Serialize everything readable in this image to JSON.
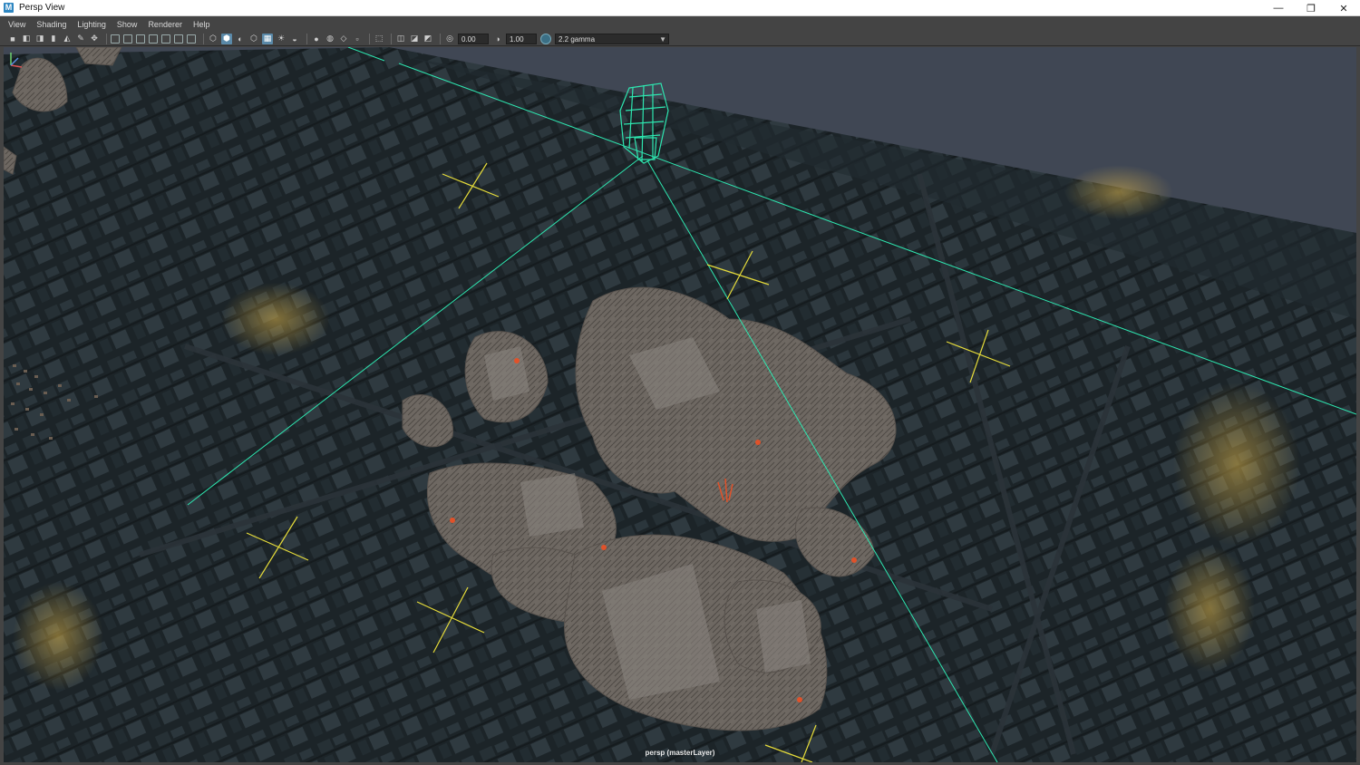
{
  "window": {
    "app_icon_letter": "M",
    "title": "Persp View",
    "controls": {
      "minimize": "—",
      "restore": "❐",
      "close": "✕"
    }
  },
  "menu": [
    "View",
    "Shading",
    "Lighting",
    "Show",
    "Renderer",
    "Help"
  ],
  "toolbar": {
    "exposure_value": "0.00",
    "gamma_value": "1.00",
    "view_transform": "2.2 gamma",
    "dropdown_arrow": "▼"
  },
  "viewport": {
    "camera_label": "persp (masterLayer)"
  },
  "colors": {
    "viewport_bg": "#404754",
    "ground_plane": "#1a2228",
    "camera_wire": "#2ee6b0",
    "locator": "#e6dc3a",
    "debris": "#6e6862"
  }
}
